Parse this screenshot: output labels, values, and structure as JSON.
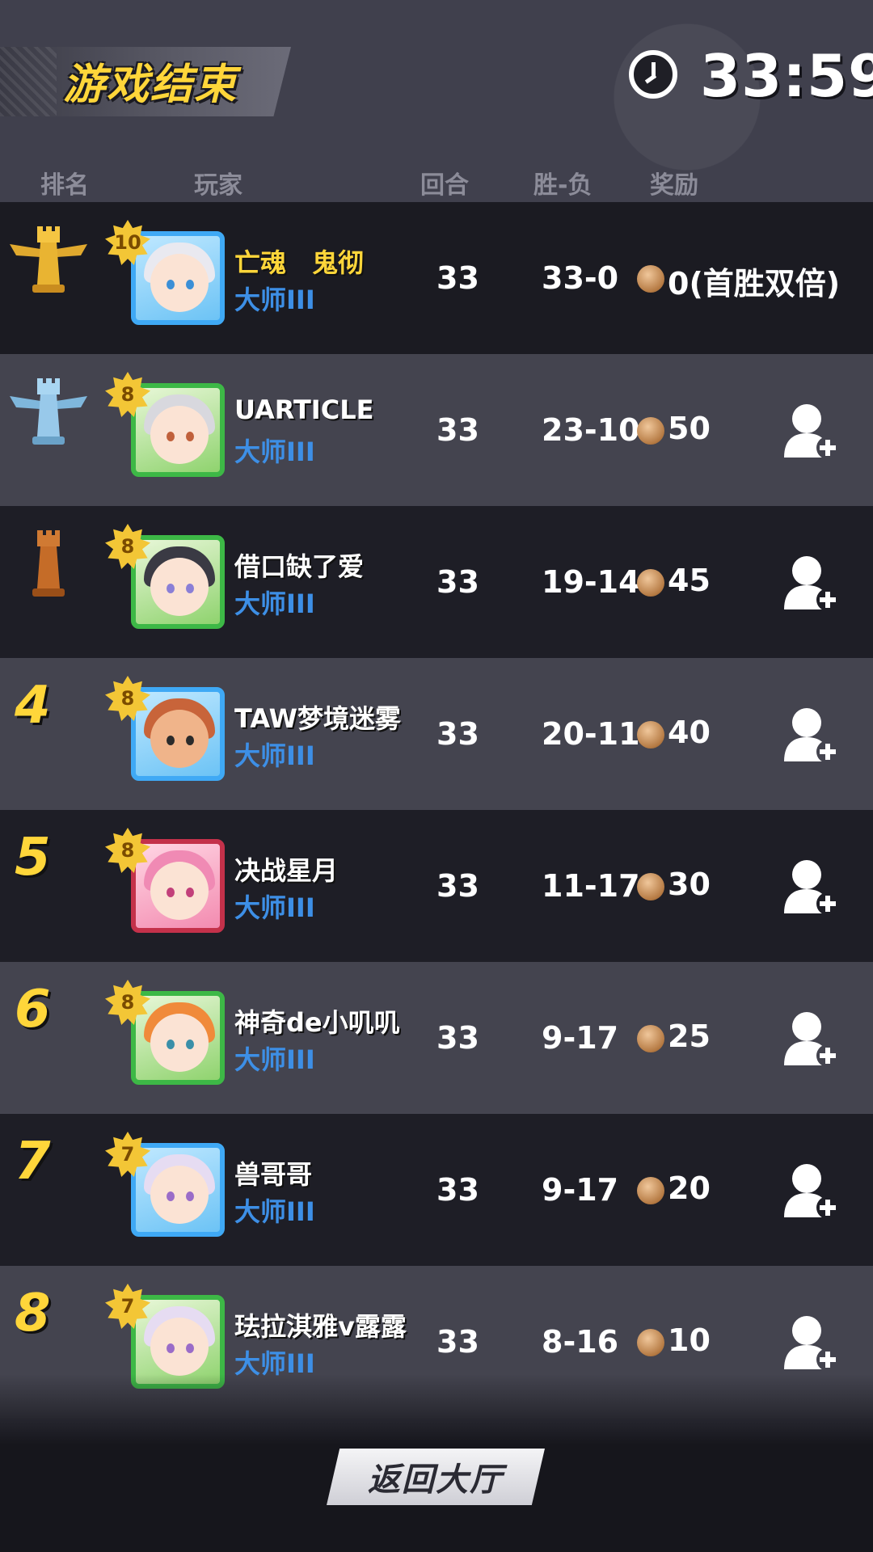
{
  "header": {
    "title": "游戏结束",
    "timer": "33:59"
  },
  "columns": {
    "rank": "排名",
    "player": "玩家",
    "rounds": "回合",
    "win_loss": "胜-负",
    "reward": "奖励"
  },
  "players": [
    {
      "rank": "1",
      "level": "10",
      "name": "亡魂　鬼彻",
      "tier": "大师III",
      "rounds": "33",
      "win_loss": "33-0",
      "reward": "0(首胜双倍)"
    },
    {
      "rank": "2",
      "level": "8",
      "name": "UARTICLE",
      "tier": "大师III",
      "rounds": "33",
      "win_loss": "23-10",
      "reward": "50"
    },
    {
      "rank": "3",
      "level": "8",
      "name": "借口缺了爱",
      "tier": "大师III",
      "rounds": "33",
      "win_loss": "19-14",
      "reward": "45"
    },
    {
      "rank": "4",
      "level": "8",
      "name": "TAW梦境迷雾",
      "tier": "大师III",
      "rounds": "33",
      "win_loss": "20-11",
      "reward": "40"
    },
    {
      "rank": "5",
      "level": "8",
      "name": "决战星月",
      "tier": "大师III",
      "rounds": "33",
      "win_loss": "11-17",
      "reward": "30"
    },
    {
      "rank": "6",
      "level": "8",
      "name": "神奇de小叽叽",
      "tier": "大师III",
      "rounds": "33",
      "win_loss": "9-17",
      "reward": "25"
    },
    {
      "rank": "7",
      "level": "7",
      "name": "兽哥哥",
      "tier": "大师III",
      "rounds": "33",
      "win_loss": "9-17",
      "reward": "20"
    },
    {
      "rank": "8",
      "level": "7",
      "name": "珐拉淇雅v露露",
      "tier": "大师III",
      "rounds": "33",
      "win_loss": "8-16",
      "reward": "10"
    }
  ],
  "footer": {
    "back_button": "返回大厅"
  },
  "colors": {
    "accent_gold": "#ffd63a",
    "tier_blue": "#3d8fe6"
  }
}
